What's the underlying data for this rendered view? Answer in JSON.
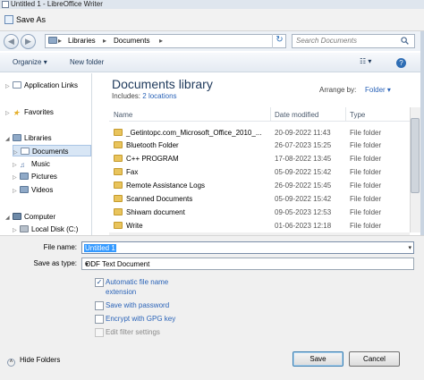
{
  "window": {
    "app_title": "Untitled 1 - LibreOffice Writer",
    "dialog_title": "Save As"
  },
  "nav": {
    "back_glyph": "◀",
    "forward_glyph": "▶",
    "breadcrumb": [
      "Libraries",
      "Documents"
    ],
    "breadcrumb_sep": "▸",
    "search_placeholder": "Search Documents"
  },
  "toolbar": {
    "organize": "Organize",
    "organize_arrow": "▾",
    "new_folder": "New folder",
    "help": "?"
  },
  "sidebar": {
    "items": [
      {
        "label": "Application Links",
        "icon": "folder-icon"
      },
      {
        "label": "Favorites",
        "icon": "star-icon"
      },
      {
        "label": "Libraries",
        "icon": "libraries-icon"
      },
      {
        "label": "Documents",
        "icon": "documents-icon"
      },
      {
        "label": "Music",
        "icon": "music-icon"
      },
      {
        "label": "Pictures",
        "icon": "pictures-icon"
      },
      {
        "label": "Videos",
        "icon": "videos-icon"
      },
      {
        "label": "Computer",
        "icon": "computer-icon"
      },
      {
        "label": "Local Disk (C:)",
        "icon": "disk-icon"
      }
    ]
  },
  "library": {
    "title": "Documents library",
    "includes_label": "Includes:",
    "includes_link": "2 locations",
    "arrange_label": "Arrange by:",
    "arrange_value": "Folder"
  },
  "columns": {
    "name": "Name",
    "date": "Date modified",
    "type": "Type"
  },
  "files": [
    {
      "name": "_Getintopc.com_Microsoft_Office_2010_...",
      "date": "20-09-2022 11:43",
      "type": "File folder"
    },
    {
      "name": "Bluetooth Folder",
      "date": "26-07-2023 15:25",
      "type": "File folder"
    },
    {
      "name": "C++ PROGRAM",
      "date": "17-08-2022 13:45",
      "type": "File folder"
    },
    {
      "name": "Fax",
      "date": "05-09-2022 15:42",
      "type": "File folder"
    },
    {
      "name": "Remote Assistance Logs",
      "date": "26-09-2022 15:45",
      "type": "File folder"
    },
    {
      "name": "Scanned Documents",
      "date": "05-09-2022 15:42",
      "type": "File folder"
    },
    {
      "name": "Shiwam document",
      "date": "09-05-2023 12:53",
      "type": "File folder"
    },
    {
      "name": "Write",
      "date": "01-06-2023 12:18",
      "type": "File folder"
    }
  ],
  "form": {
    "file_name_label": "File name:",
    "file_name_value": "Untitled 1",
    "save_type_label": "Save as type:",
    "save_type_value": "ODF Text Document",
    "dropdown_arrow": "▾"
  },
  "options": {
    "auto_ext_line1": "Automatic file name",
    "auto_ext_line2": "extension",
    "auto_ext_checked": "✓",
    "save_password": "Save with password",
    "encrypt_gpg": "Encrypt with GPG key",
    "edit_filter": "Edit filter settings"
  },
  "footer": {
    "hide_folders": "Hide Folders",
    "hide_glyph": "˄",
    "save": "Save",
    "cancel": "Cancel"
  }
}
